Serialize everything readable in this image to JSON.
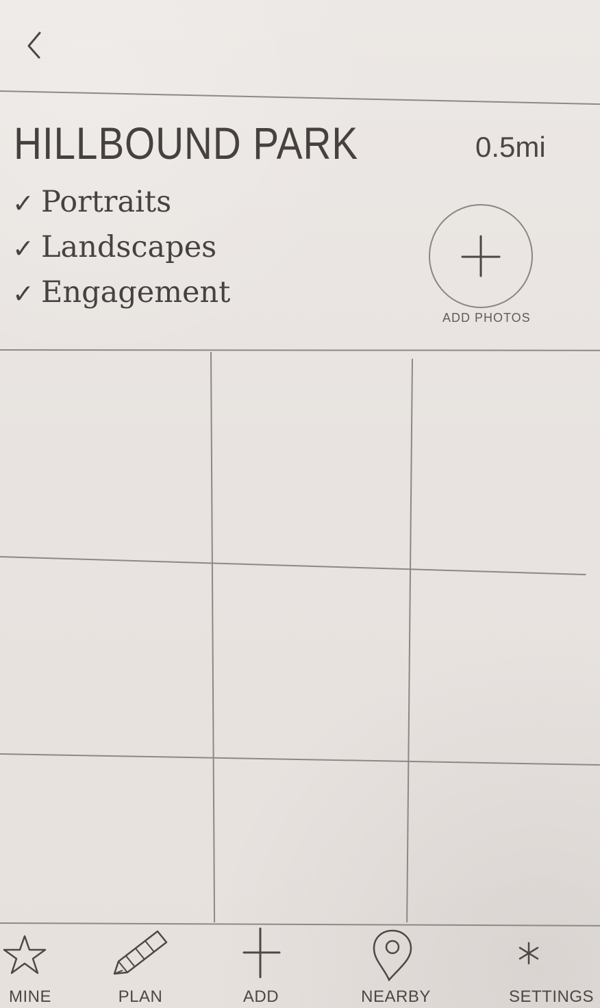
{
  "header": {
    "back_icon": "chevron-left-icon"
  },
  "place": {
    "name": "HILLBOUND PARK",
    "distance": "0.5mi",
    "tags": [
      {
        "label": "Portraits"
      },
      {
        "label": "Landscapes"
      },
      {
        "label": "Engagement"
      }
    ]
  },
  "add_photos": {
    "icon": "plus-icon",
    "label": "ADD PHOTOS"
  },
  "photo_grid": {
    "rows": 3,
    "columns": 3,
    "cells": 9
  },
  "tabbar": {
    "items": [
      {
        "label": "MINE",
        "icon": "star-icon"
      },
      {
        "label": "PLAN",
        "icon": "pencil-icon"
      },
      {
        "label": "ADD",
        "icon": "plus-icon"
      },
      {
        "label": "NEARBY",
        "icon": "map-pin-icon"
      },
      {
        "label": "SETTINGS",
        "icon": "asterisk-icon"
      }
    ]
  }
}
